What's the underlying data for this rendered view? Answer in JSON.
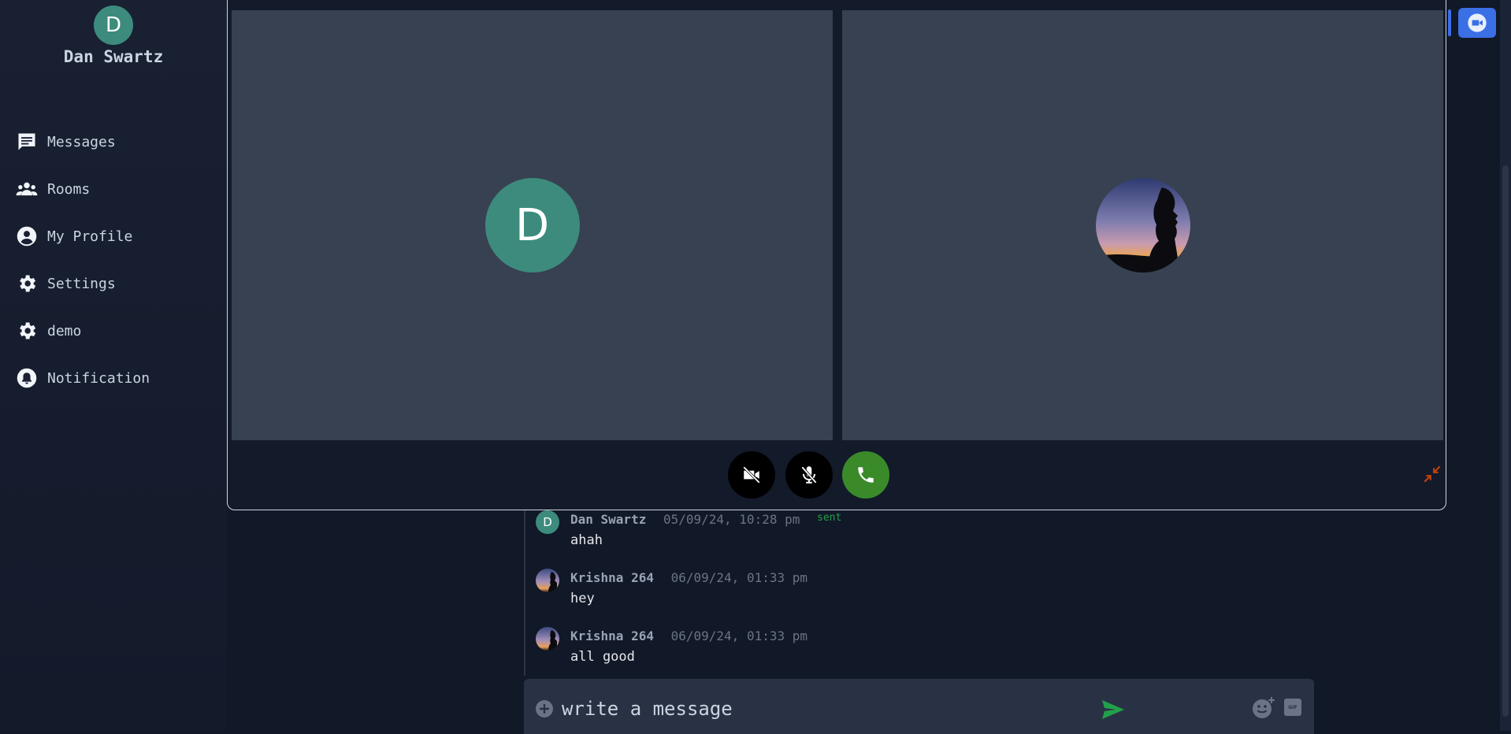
{
  "user": {
    "initial": "D",
    "name": "Dan Swartz"
  },
  "nav": [
    {
      "label": "Messages",
      "icon": "message-icon"
    },
    {
      "label": "Rooms",
      "icon": "people-icon"
    },
    {
      "label": "My Profile",
      "icon": "user-icon"
    },
    {
      "label": "Settings",
      "icon": "gear-icon"
    },
    {
      "label": "demo",
      "icon": "gear-icon"
    },
    {
      "label": "Notification",
      "icon": "bell-icon"
    }
  ],
  "call": {
    "local_initial": "D",
    "video_state": "off",
    "mic_state": "muted",
    "colors": {
      "phone_button": "#3a8a2a",
      "minimize": "#c2410c"
    }
  },
  "messages": [
    {
      "sender": "Dan Swartz",
      "time": "05/09/24, 10:28 pm",
      "status": "sent",
      "text": "ahah",
      "avatar_initial": "D"
    },
    {
      "sender": "Krishna 264",
      "time": "06/09/24, 01:33 pm",
      "text": "hey"
    },
    {
      "sender": "Krishna 264",
      "time": "06/09/24, 01:33 pm",
      "text": "all good"
    }
  ],
  "composer": {
    "placeholder": "write a message",
    "gif_label": "GIF"
  },
  "colors": {
    "accent": "#3b6fe6",
    "avatar": "#3d8b7d",
    "send": "#22a04b",
    "background": "#111827"
  }
}
